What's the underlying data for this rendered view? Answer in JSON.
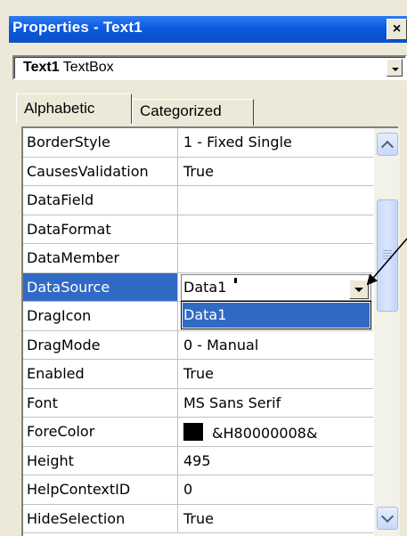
{
  "window": {
    "title": "Properties - Text1",
    "close_glyph": "×"
  },
  "object_selector": {
    "object_name": "Text1",
    "object_type": "TextBox"
  },
  "tabs": [
    {
      "label": "Alphabetic",
      "active": true
    },
    {
      "label": "Categorized",
      "active": false
    }
  ],
  "properties": [
    {
      "name": "BorderStyle",
      "value": "1 - Fixed Single"
    },
    {
      "name": "CausesValidation",
      "value": "True"
    },
    {
      "name": "DataField",
      "value": ""
    },
    {
      "name": "DataFormat",
      "value": ""
    },
    {
      "name": "DataMember",
      "value": ""
    },
    {
      "name": "DataSource",
      "value": "Data1"
    },
    {
      "name": "DragIcon",
      "value": ""
    },
    {
      "name": "DragMode",
      "value": "0 - Manual"
    },
    {
      "name": "Enabled",
      "value": "True"
    },
    {
      "name": "Font",
      "value": "MS Sans Serif"
    },
    {
      "name": "ForeColor",
      "value": "&H80000008&"
    },
    {
      "name": "Height",
      "value": "495"
    },
    {
      "name": "HelpContextID",
      "value": "0"
    },
    {
      "name": "HideSelection",
      "value": "True"
    }
  ],
  "dropdown": {
    "options": [
      "Data1"
    ],
    "selected": "Data1"
  },
  "colors": {
    "titlebar": "#0a56d6",
    "selection": "#316ac5",
    "face": "#ece9d8",
    "forecolor_swatch": "#000000"
  },
  "icons": {
    "close": "close-icon",
    "dropdown": "chevron-down-icon",
    "scroll_up": "chevron-up-icon",
    "scroll_down": "chevron-down-icon",
    "annotation": "arrow-icon"
  }
}
